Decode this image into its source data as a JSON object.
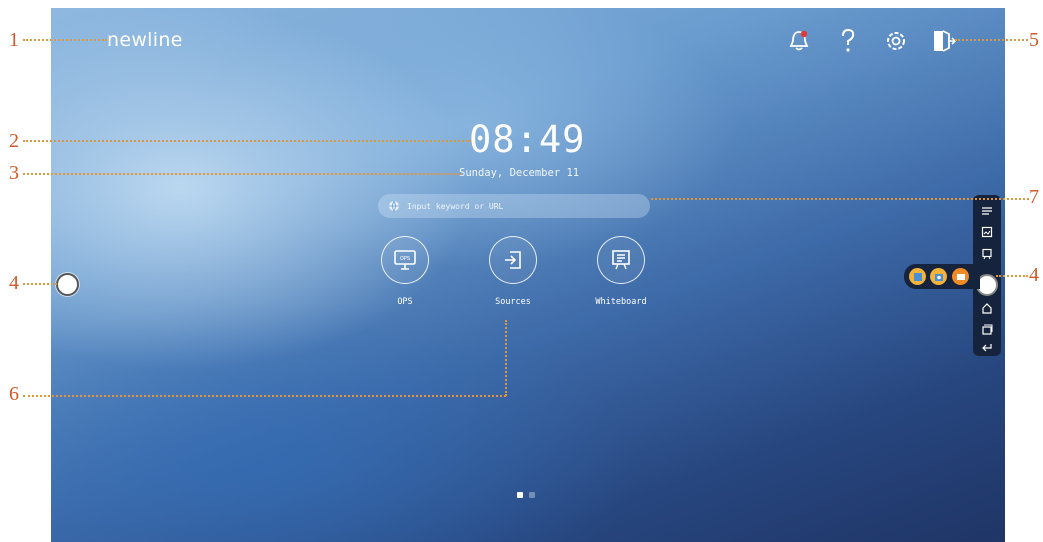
{
  "brand": {
    "logo": "newline"
  },
  "clock": {
    "time": "08:49",
    "date": "Sunday, December 11"
  },
  "search": {
    "placeholder": "Input keyword or URL"
  },
  "apps": [
    {
      "label": "OPS",
      "icon": "ops-icon"
    },
    {
      "label": "Sources",
      "icon": "sources-icon"
    },
    {
      "label": "Whiteboard",
      "icon": "whiteboard-icon"
    }
  ],
  "topbar": {
    "icons": [
      "notification-bell-icon",
      "help-icon",
      "settings-icon",
      "exit-icon"
    ],
    "notification_color": "#e53935"
  },
  "sidebar_toolbar": {
    "icons": [
      "annotation-icon",
      "screenshot-icon",
      "whiteboard-small-icon",
      "home-icon",
      "task-view-icon",
      "back-icon"
    ]
  },
  "tray": {
    "icons": [
      "gallery-icon",
      "camera-icon",
      "message-icon"
    ],
    "colors": [
      "#f3b23a",
      "#f3b23a",
      "#f08a24"
    ]
  },
  "pagination": {
    "pages": 2,
    "current": 1
  },
  "callouts": [
    "1",
    "2",
    "3",
    "4",
    "5",
    "6",
    "7",
    "4"
  ],
  "colors": {
    "callout": "#d05a2a",
    "leader": "#e0963a",
    "toolbar": "#15233d"
  }
}
